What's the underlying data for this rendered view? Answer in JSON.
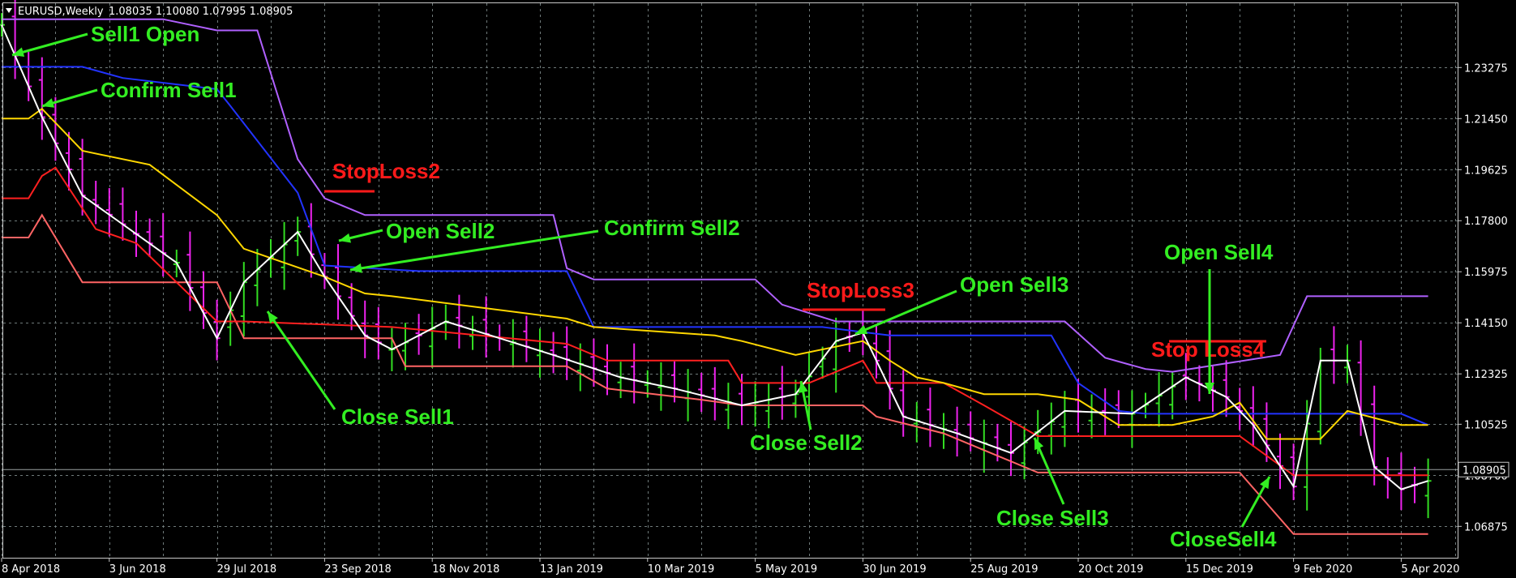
{
  "window": {
    "symbol_title": "EURUSD,Weekly",
    "ohlc": "1.08035 1.10080 1.07995 1.08905"
  },
  "chart_data": {
    "type": "line",
    "title": "EURUSD,Weekly",
    "ylim": [
      1.055,
      1.255
    ],
    "y_ticks": [
      "1.23275",
      "1.21450",
      "1.19625",
      "1.17800",
      "1.15975",
      "1.14150",
      "1.12325",
      "1.10525",
      "1.08700",
      "1.06875"
    ],
    "y_tick_values": [
      1.23275,
      1.2145,
      1.19625,
      1.178,
      1.15975,
      1.1415,
      1.12325,
      1.10525,
      1.087,
      1.06875
    ],
    "x_ticks": [
      "8 Apr 2018",
      "3 Jun 2018",
      "29 Jul 2018",
      "23 Sep 2018",
      "18 Nov 2018",
      "13 Jan 2019",
      "10 Mar 2019",
      "5 May 2019",
      "30 Jun 2019",
      "25 Aug 2019",
      "20 Oct 2019",
      "15 Dec 2019",
      "9 Feb 2020",
      "5 Apr 2020"
    ],
    "x_tick_weeks": [
      0,
      8,
      16,
      24,
      32,
      40,
      48,
      56,
      64,
      72,
      80,
      88,
      96,
      104
    ],
    "current_price": "1.08905",
    "current_value": 1.08905,
    "grid": true,
    "series": [
      {
        "color": "#ffffff",
        "x": [
          0,
          3,
          6,
          13,
          16,
          18,
          22,
          24,
          27,
          29,
          33,
          41,
          46,
          50,
          55,
          59,
          62,
          64,
          67,
          71,
          75,
          79,
          84,
          88,
          91,
          93,
          96,
          98,
          100,
          102,
          104,
          106
        ],
        "values": [
          1.248,
          1.215,
          1.187,
          1.163,
          1.136,
          1.156,
          1.174,
          1.158,
          1.137,
          1.132,
          1.142,
          1.13,
          1.122,
          1.118,
          1.112,
          1.116,
          1.135,
          1.138,
          1.108,
          1.102,
          1.095,
          1.11,
          1.109,
          1.122,
          1.115,
          1.105,
          1.083,
          1.128,
          1.128,
          1.09,
          1.082,
          1.085
        ]
      },
      {
        "color": "#ffd700",
        "x": [
          0,
          2,
          3,
          6,
          11,
          16,
          18,
          24,
          27,
          29,
          42,
          44,
          53,
          55,
          59,
          64,
          66,
          68,
          70,
          73,
          77,
          80,
          83,
          87,
          90,
          92,
          94,
          98,
          100,
          104,
          106
        ],
        "values": [
          1.2145,
          1.2145,
          1.218,
          1.203,
          1.198,
          1.18,
          1.168,
          1.158,
          1.152,
          1.151,
          1.143,
          1.14,
          1.137,
          1.135,
          1.13,
          1.135,
          1.128,
          1.122,
          1.12,
          1.116,
          1.116,
          1.114,
          1.105,
          1.105,
          1.108,
          1.113,
          1.1,
          1.1,
          1.11,
          1.105,
          1.105
        ]
      },
      {
        "color": "#ff2020",
        "x": [
          0,
          2,
          3,
          4,
          7,
          10,
          16,
          18,
          29,
          42,
          45,
          54,
          55,
          60,
          64,
          65,
          70,
          73,
          77,
          92,
          96,
          106
        ],
        "values": [
          1.186,
          1.186,
          1.194,
          1.197,
          1.175,
          1.17,
          1.142,
          1.142,
          1.14,
          1.134,
          1.128,
          1.128,
          1.12,
          1.12,
          1.128,
          1.12,
          1.12,
          1.112,
          1.101,
          1.101,
          1.087,
          1.087
        ]
      },
      {
        "color": "#ff6464",
        "x": [
          0,
          2,
          3,
          6,
          16,
          18,
          29,
          30,
          42,
          45,
          52,
          55,
          64,
          65,
          70,
          73,
          77,
          92,
          96,
          98,
          106
        ],
        "values": [
          1.172,
          1.172,
          1.18,
          1.156,
          1.156,
          1.136,
          1.136,
          1.126,
          1.126,
          1.118,
          1.114,
          1.112,
          1.112,
          1.108,
          1.102,
          1.096,
          1.088,
          1.088,
          1.066,
          1.066,
          1.066
        ]
      },
      {
        "color": "#2233ff",
        "x": [
          0,
          6,
          9,
          16,
          17,
          22,
          24,
          31,
          42,
          44,
          61,
          66,
          78,
          80,
          83,
          85,
          104,
          106
        ],
        "values": [
          1.233,
          1.233,
          1.229,
          1.225,
          1.219,
          1.188,
          1.162,
          1.16,
          1.16,
          1.14,
          1.14,
          1.137,
          1.137,
          1.12,
          1.11,
          1.109,
          1.109,
          1.105
        ]
      },
      {
        "color": "#b060ff",
        "x": [
          0,
          12,
          16,
          19,
          22,
          24,
          27,
          41,
          42,
          44,
          56,
          58,
          62,
          79,
          82,
          85,
          87,
          95,
          97,
          106
        ],
        "values": [
          1.25,
          1.25,
          1.246,
          1.246,
          1.2,
          1.186,
          1.18,
          1.18,
          1.161,
          1.157,
          1.157,
          1.148,
          1.142,
          1.142,
          1.129,
          1.125,
          1.124,
          1.13,
          1.151,
          1.151
        ]
      }
    ],
    "annotations": {
      "sell1_open": "Sell1 Open",
      "confirm_sell1": "Confirm Sell1",
      "stoploss2": "StopLoss2",
      "open_sell2": "Open Sell2",
      "confirm_sell2": "Confirm Sell2",
      "close_sell1": "Close Sell1",
      "stoploss3": "StopLoss3",
      "open_sell3": "Open Sell3",
      "close_sell2": "Close Sell2",
      "stop_loss4": "Stop  Loss4",
      "open_sell4": "Open Sell4",
      "close_sell3": "Close Sell3",
      "close_sell4": "CloseSell4"
    },
    "colors": {
      "annotation_green": "#33ee22",
      "annotation_red": "#ff1a1a",
      "bull_bar": "#33dd22",
      "bear_bar": "#ee22ee",
      "grid": "#6f7a7a"
    }
  }
}
